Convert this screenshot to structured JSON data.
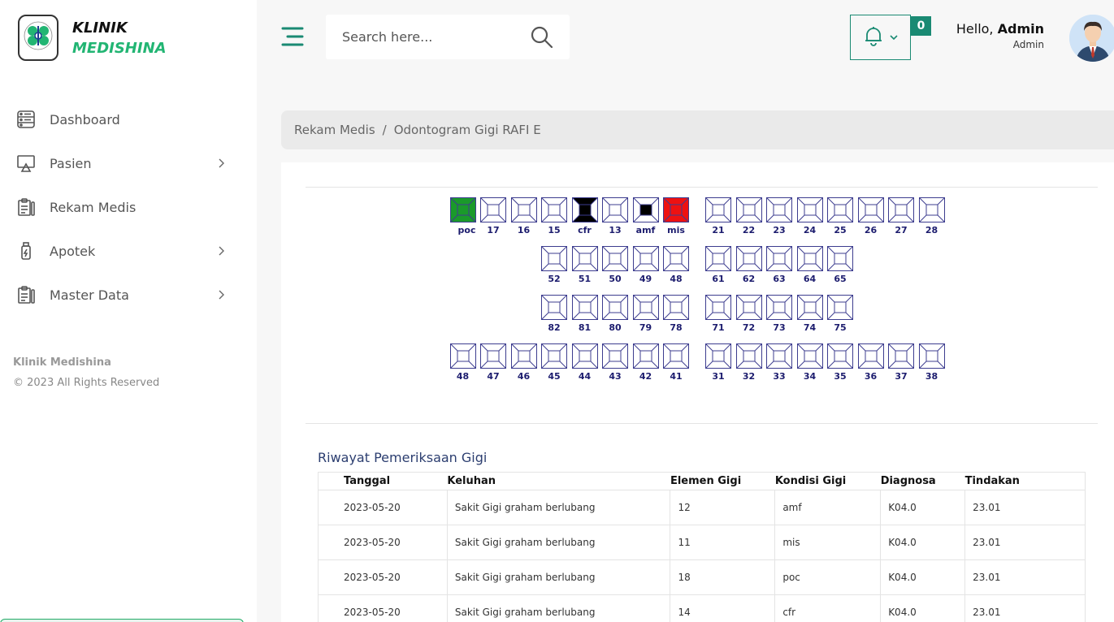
{
  "app": {
    "name_line1": "KLINIK",
    "name_line2": "MEDISHINA"
  },
  "sidebar": {
    "items": [
      {
        "label": "Dashboard",
        "icon": "dashboard-icon",
        "has_submenu": false
      },
      {
        "label": "Pasien",
        "icon": "monitor-icon",
        "has_submenu": true
      },
      {
        "label": "Rekam Medis",
        "icon": "clipboard-icon",
        "has_submenu": false
      },
      {
        "label": "Apotek",
        "icon": "medicine-bottle-icon",
        "has_submenu": true
      },
      {
        "label": "Master Data",
        "icon": "clipboard-icon",
        "has_submenu": true
      }
    ],
    "footer_brand": "Klinik Medishina",
    "footer_copy": "© 2023 All Rights Reserved"
  },
  "header": {
    "search_placeholder": "Search here...",
    "notification_count": "0",
    "greeting": "Hello,",
    "user_name": "Admin",
    "user_role": "Admin"
  },
  "breadcrumb": {
    "parent": "Rekam Medis",
    "separator": "/",
    "current": "Odontogram Gigi RAFI E"
  },
  "colors": {
    "accent": "#1a8a73",
    "brand_green": "#22b573",
    "tooth_outline": "#3d3d8f",
    "poc": "#1a9a2a",
    "mis": "#ee1111",
    "cfr_amf": "#000000"
  },
  "odontogram": {
    "rows": [
      {
        "left": [
          {
            "label": "poc",
            "status": "poc"
          },
          {
            "label": "17"
          },
          {
            "label": "16"
          },
          {
            "label": "15"
          },
          {
            "label": "cfr",
            "status": "cfr"
          },
          {
            "label": "13"
          },
          {
            "label": "amf",
            "status": "amf"
          },
          {
            "label": "mis",
            "status": "mis"
          }
        ],
        "right": [
          {
            "label": "21"
          },
          {
            "label": "22"
          },
          {
            "label": "23"
          },
          {
            "label": "24"
          },
          {
            "label": "25"
          },
          {
            "label": "26"
          },
          {
            "label": "27"
          },
          {
            "label": "28"
          }
        ]
      },
      {
        "left": [
          {
            "label": "52"
          },
          {
            "label": "51"
          },
          {
            "label": "50"
          },
          {
            "label": "49"
          },
          {
            "label": "48"
          }
        ],
        "right": [
          {
            "label": "61"
          },
          {
            "label": "62"
          },
          {
            "label": "63"
          },
          {
            "label": "64"
          },
          {
            "label": "65"
          }
        ]
      },
      {
        "left": [
          {
            "label": "82"
          },
          {
            "label": "81"
          },
          {
            "label": "80"
          },
          {
            "label": "79"
          },
          {
            "label": "78"
          }
        ],
        "right": [
          {
            "label": "71"
          },
          {
            "label": "72"
          },
          {
            "label": "73"
          },
          {
            "label": "74"
          },
          {
            "label": "75"
          }
        ]
      },
      {
        "left": [
          {
            "label": "48"
          },
          {
            "label": "47"
          },
          {
            "label": "46"
          },
          {
            "label": "45"
          },
          {
            "label": "44"
          },
          {
            "label": "43"
          },
          {
            "label": "42"
          },
          {
            "label": "41"
          }
        ],
        "right": [
          {
            "label": "31"
          },
          {
            "label": "32"
          },
          {
            "label": "33"
          },
          {
            "label": "34"
          },
          {
            "label": "35"
          },
          {
            "label": "36"
          },
          {
            "label": "37"
          },
          {
            "label": "38"
          }
        ]
      }
    ]
  },
  "history": {
    "title": "Riwayat Pemeriksaan Gigi",
    "columns": [
      "Tanggal",
      "Keluhan",
      "Elemen Gigi",
      "Kondisi Gigi",
      "Diagnosa",
      "Tindakan"
    ],
    "rows": [
      [
        "2023-05-20",
        "Sakit Gigi graham berlubang",
        "12",
        "amf",
        "K04.0",
        "23.01"
      ],
      [
        "2023-05-20",
        "Sakit Gigi graham berlubang",
        "11",
        "mis",
        "K04.0",
        "23.01"
      ],
      [
        "2023-05-20",
        "Sakit Gigi graham berlubang",
        "18",
        "poc",
        "K04.0",
        "23.01"
      ],
      [
        "2023-05-20",
        "Sakit Gigi graham berlubang",
        "14",
        "cfr",
        "K04.0",
        "23.01"
      ]
    ]
  }
}
